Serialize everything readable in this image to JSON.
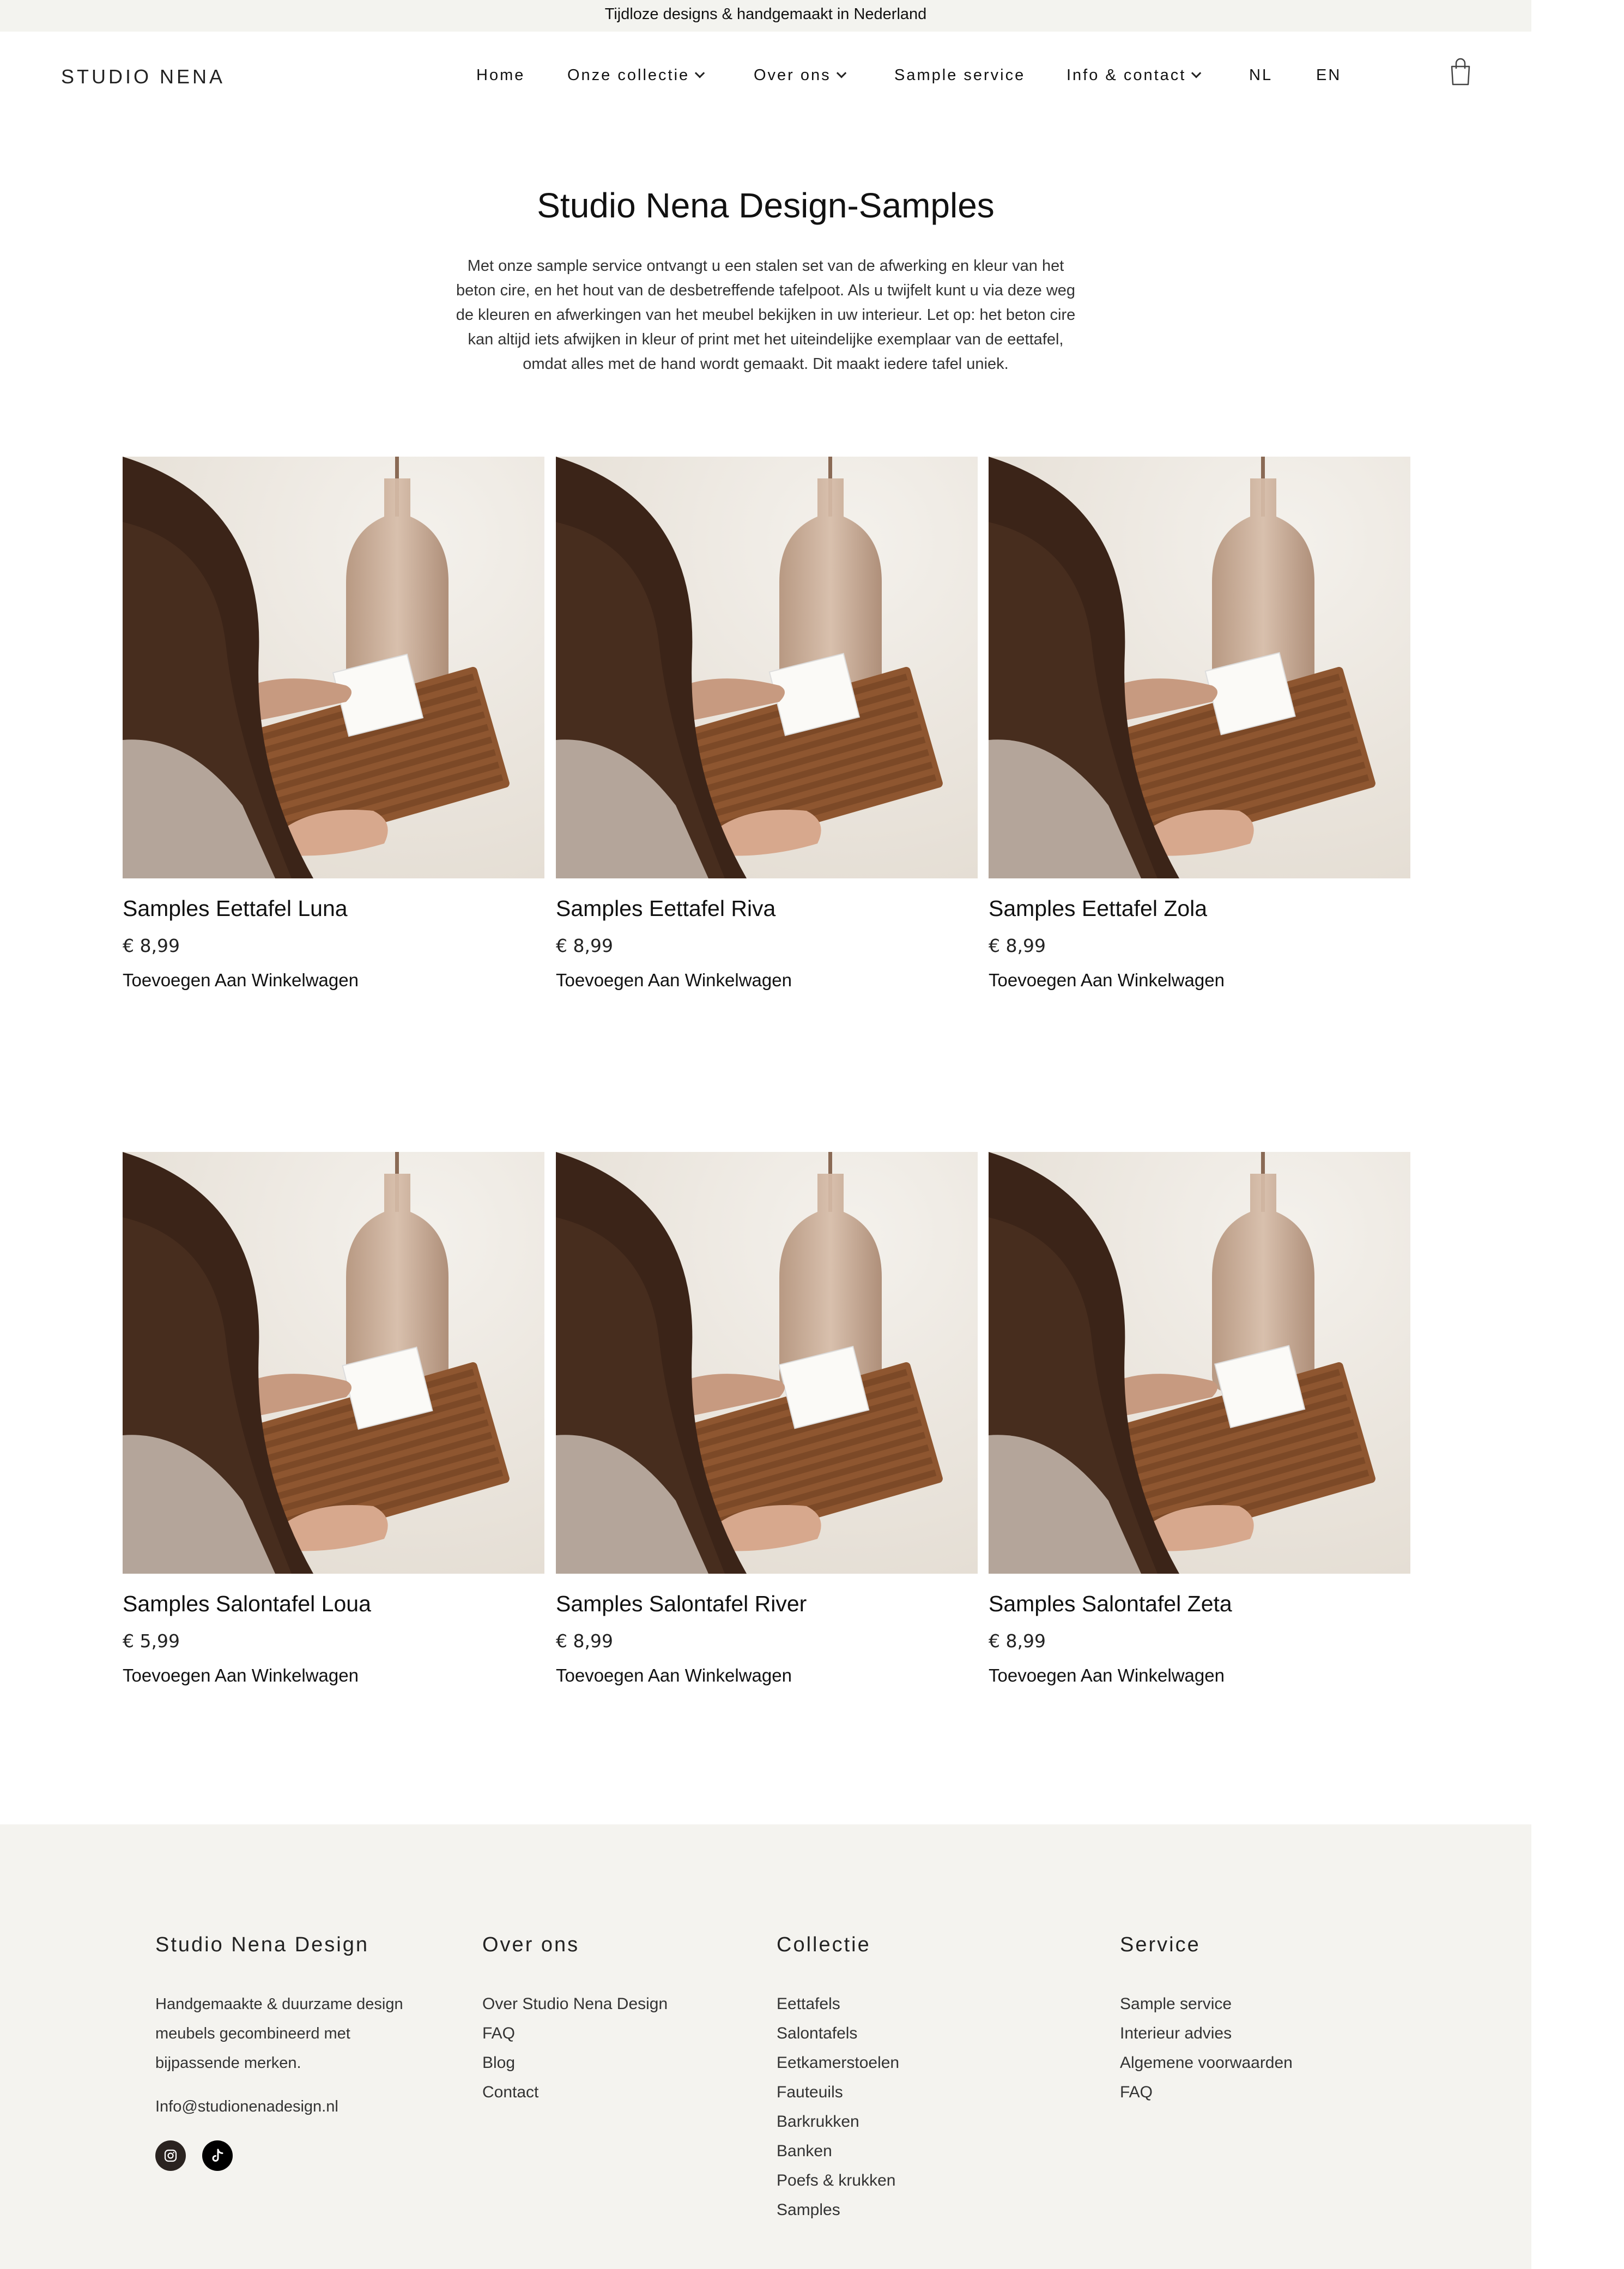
{
  "announcement": "Tijdloze designs & handgemaakt in Nederland",
  "header": {
    "logo": "STUDIO NENA",
    "nav": [
      {
        "label": "Home"
      },
      {
        "label": "Onze collectie"
      },
      {
        "label": "Over ons"
      },
      {
        "label": "Sample service"
      },
      {
        "label": "Info & contact"
      },
      {
        "label": "NL"
      },
      {
        "label": "EN"
      }
    ],
    "cart_icon": "shopping-bag-icon"
  },
  "intro": {
    "title": "Studio Nena Design-Samples",
    "text": "Met onze sample service ontvangt u een stalen set van de afwerking en kleur van het beton cire, en het hout van de desbetreffende tafelpoot. Als u twijfelt kunt u via deze weg de kleuren en afwerkingen van het meubel bekijken in uw interieur. Let op: het beton cire kan altijd iets afwijken in kleur of print met het uiteindelijke exemplaar van de eettafel, omdat alles met de hand wordt gemaakt. Dit maakt iedere tafel uniek."
  },
  "products": [
    {
      "name": "Samples Eettafel Luna",
      "price": "€ 8,99",
      "cta": "Toevoegen Aan Winkelwagen"
    },
    {
      "name": "Samples Eettafel Riva",
      "price": "€ 8,99",
      "cta": "Toevoegen Aan Winkelwagen"
    },
    {
      "name": "Samples Eettafel Zola",
      "price": "€ 8,99",
      "cta": "Toevoegen Aan Winkelwagen"
    },
    {
      "name": "Samples Salontafel Loua",
      "price": "€ 5,99",
      "cta": "Toevoegen Aan Winkelwagen"
    },
    {
      "name": "Samples Salontafel River",
      "price": "€ 8,99",
      "cta": "Toevoegen Aan Winkelwagen"
    },
    {
      "name": "Samples Salontafel Zeta",
      "price": "€ 8,99",
      "cta": "Toevoegen Aan Winkelwagen"
    }
  ],
  "footer": {
    "about": {
      "heading": "Studio Nena Design",
      "text": "Handgemaakte & duurzame design meubels gecombineerd met bijpassende merken.",
      "email": "Info@studionenadesign.nl",
      "social": [
        "instagram-icon",
        "tiktok-icon"
      ]
    },
    "over_ons": {
      "heading": "Over ons",
      "links": [
        "Over Studio Nena Design",
        "FAQ",
        "Blog",
        "Contact"
      ]
    },
    "collectie": {
      "heading": "Collectie",
      "links": [
        "Eettafels",
        "Salontafels",
        "Eetkamerstoelen",
        "Fauteuils",
        "Barkrukken",
        "Banken",
        "Poefs & krukken",
        "Samples"
      ]
    },
    "service": {
      "heading": "Service",
      "links": [
        "Sample service",
        "Interieur advies",
        "Algemene voorwaarden",
        "FAQ"
      ]
    }
  },
  "colors": {
    "announcement_bg": "#f3f3ef",
    "footer_bg": "#f4f3ef",
    "text": "#111111"
  }
}
